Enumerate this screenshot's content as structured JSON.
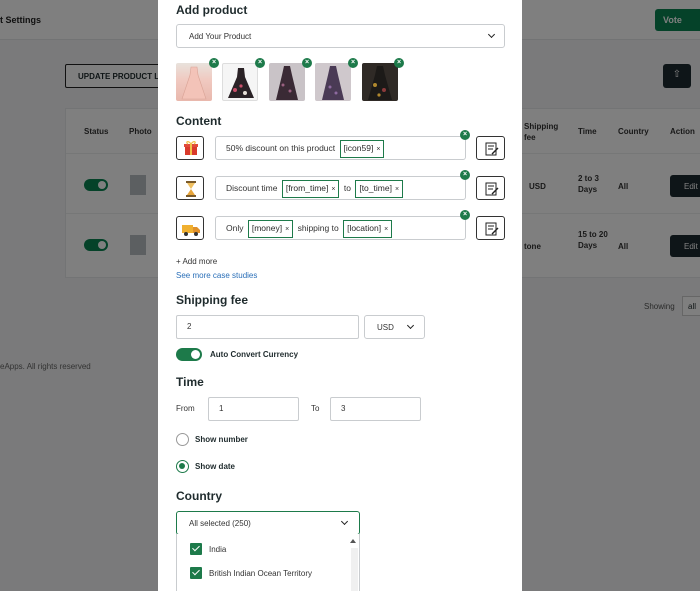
{
  "background": {
    "header_title": "t Settings",
    "vote_label": "Vote",
    "update_button": "UPDATE PRODUCT LIS",
    "upload_icon": "upload-icon",
    "table_headers": [
      "Status",
      "Photo",
      "Shipping fee",
      "Time",
      "Country",
      "Action"
    ],
    "rows": [
      {
        "shipping": "USD",
        "time": "2 to 3 Days",
        "country": "All",
        "action": "Edit"
      },
      {
        "shipping": "tone",
        "time": "15 to 20 Days",
        "country": "All",
        "action": "Edit"
      }
    ],
    "showing_label": "Showing",
    "showing_value": "all",
    "footer": "eApps. All rights reserved"
  },
  "modal": {
    "add_product": {
      "title": "Add product",
      "dropdown_placeholder": "Add Your Product",
      "thumbnails": [
        "product-dress-1",
        "product-dress-2",
        "product-dress-3",
        "product-dress-4",
        "product-dress-5"
      ]
    },
    "content": {
      "title": "Content",
      "messages": [
        {
          "icon": "gift-icon",
          "prefix": "50% discount on this product",
          "tags": [
            "[icon59]"
          ],
          "middle": "",
          "suffix": ""
        },
        {
          "icon": "hourglass-icon",
          "prefix": "Discount time",
          "tags": [
            "[from_time]",
            "[to_time]"
          ],
          "middle": "to",
          "suffix": ""
        },
        {
          "icon": "truck-icon",
          "prefix": "Only",
          "tags": [
            "[money]",
            "[location]"
          ],
          "middle": "shipping to",
          "suffix": ""
        }
      ],
      "add_more": "+ Add more",
      "case_studies": "See more case studies"
    },
    "shipping": {
      "title": "Shipping fee",
      "value": "2",
      "currency": "USD",
      "auto_convert": "Auto Convert Currency"
    },
    "time": {
      "title": "Time",
      "from_label": "From",
      "from_value": "1",
      "to_label": "To",
      "to_value": "3",
      "show_number": "Show number",
      "show_date": "Show date"
    },
    "country": {
      "title": "Country",
      "selected": "All selected (250)",
      "items": [
        "India",
        "British Indian Ocean Territory"
      ]
    }
  },
  "colors": {
    "accent": "#1d7a4a",
    "dark": "#1d2b30",
    "overlay": "rgba(0,0,0,0.5)"
  }
}
